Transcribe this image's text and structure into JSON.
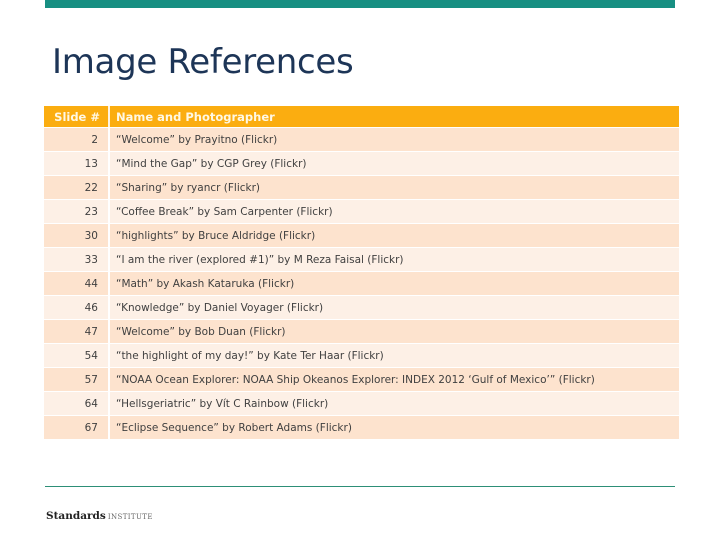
{
  "accent_colors": {
    "top_bar": "#178f82",
    "header": "#fbad10",
    "row_odd": "#fde3ce",
    "row_even": "#fdf0e6",
    "footer_line": "#2d8f77"
  },
  "title": "Image References",
  "table": {
    "headers": [
      "Slide #",
      "Name and Photographer"
    ],
    "rows": [
      {
        "slide": "2",
        "credit": "“Welcome” by Prayitno (Flickr)"
      },
      {
        "slide": "13",
        "credit": "“Mind the Gap” by CGP Grey (Flickr)"
      },
      {
        "slide": "22",
        "credit": "“Sharing” by ryancr (Flickr)"
      },
      {
        "slide": "23",
        "credit": "“Coffee Break” by Sam Carpenter (Flickr)"
      },
      {
        "slide": "30",
        "credit": "“highlights” by Bruce Aldridge (Flickr)"
      },
      {
        "slide": "33",
        "credit": "“I am the river (explored #1)” by M Reza Faisal (Flickr)"
      },
      {
        "slide": "44",
        "credit": "“Math” by Akash Kataruka (Flickr)"
      },
      {
        "slide": "46",
        "credit": "“Knowledge” by Daniel Voyager (Flickr)"
      },
      {
        "slide": "47",
        "credit": "“Welcome” by Bob Duan (Flickr)"
      },
      {
        "slide": "54",
        "credit": "“the highlight of my day!” by Kate Ter Haar (Flickr)"
      },
      {
        "slide": "57",
        "credit": "“NOAA Ocean Explorer: NOAA Ship Okeanos Explorer: INDEX 2012 ‘Gulf of Mexico’” (Flickr)"
      },
      {
        "slide": "64",
        "credit": "“Hellsgeriatric” by Vít C Rainbow (Flickr)"
      },
      {
        "slide": "67",
        "credit": "“Eclipse Sequence” by Robert Adams (Flickr)"
      }
    ]
  },
  "footer": {
    "brand_bold": "Standards",
    "brand_light": "INSTITUTE"
  }
}
